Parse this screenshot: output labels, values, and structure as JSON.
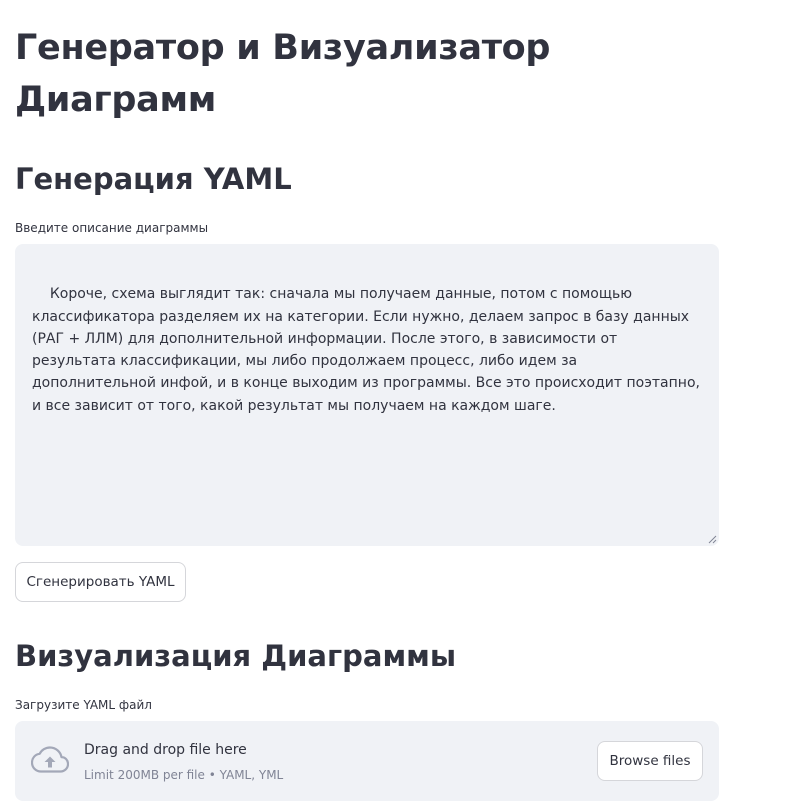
{
  "page": {
    "title": "Генератор и Визуализатор Диаграмм"
  },
  "yaml_generation": {
    "heading": "Генерация YAML",
    "input_label": "Введите описание диаграммы",
    "input_value": "Короче, схема выглядит так: сначала мы получаем данные, потом с помощью классификатора разделяем их на категории. Если нужно, делаем запрос в базу данных (РАГ + ЛЛМ) для дополнительной информации. После этого, в зависимости от результата классификации, мы либо продолжаем процесс, либо идем за дополнительной инфой, и в конце выходим из программы. Все это происходит поэтапно, и все зависит от того, какой результат мы получаем на каждом шаге.",
    "generate_button": "Сгенерировать YAML"
  },
  "visualization": {
    "heading": "Визуализация Диаграммы",
    "upload_label": "Загрузите YAML файл",
    "dropzone_title": "Drag and drop file here",
    "dropzone_subtitle": "Limit 200MB per file • YAML, YML",
    "browse_button": "Browse files",
    "icon": "cloud-upload-icon"
  },
  "colors": {
    "text": "#31333f",
    "input_background": "#f0f2f6",
    "muted_text": "#808495",
    "border": "#d5d6da"
  }
}
